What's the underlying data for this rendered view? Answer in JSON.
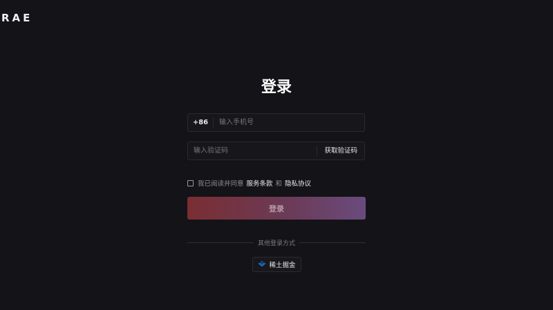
{
  "header": {
    "logo_text": "RAE"
  },
  "login": {
    "title": "登录",
    "phone": {
      "prefix": "+86",
      "placeholder": "输入手机号",
      "value": ""
    },
    "code": {
      "placeholder": "输入验证码",
      "value": "",
      "get_code_label": "获取验证码"
    },
    "agreement": {
      "prefix_text": "我已阅读并同意",
      "terms_label": "服务条款",
      "and_text": "和",
      "privacy_label": "隐私协议",
      "checked": false
    },
    "submit_label": "登录",
    "other_methods_label": "其他登录方式",
    "juejin_label": "稀土掘金"
  },
  "colors": {
    "background": "#131318",
    "button_gradient_start": "#7a2e33",
    "button_gradient_end": "#6a4b7d",
    "juejin_icon": "#1e80ff"
  },
  "icons": {
    "juejin": "juejin-logo-icon"
  }
}
